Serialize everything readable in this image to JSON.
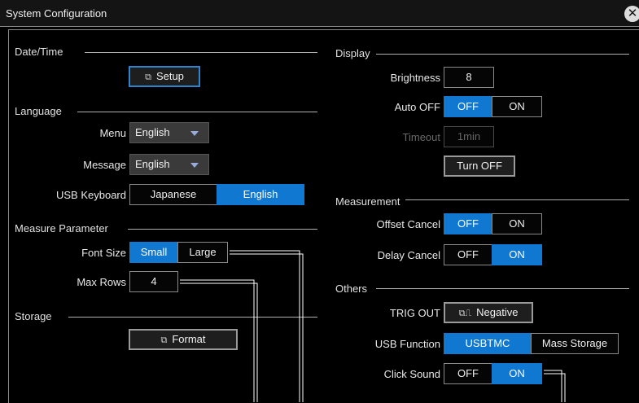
{
  "window": {
    "title": "System Configuration",
    "close_glyph": "✕"
  },
  "datetime": {
    "section": "Date/Time",
    "setup_label": "Setup",
    "setup_icon": "popup-icon"
  },
  "language": {
    "section": "Language",
    "menu_label": "Menu",
    "menu_value": "English",
    "message_label": "Message",
    "message_value": "English",
    "usb_keyboard_label": "USB Keyboard",
    "usb_keyboard_options": [
      "Japanese",
      "English"
    ],
    "usb_keyboard_selected": "English"
  },
  "measure_parameter": {
    "section": "Measure Parameter",
    "font_size_label": "Font Size",
    "font_size_options": [
      "Small",
      "Large"
    ],
    "font_size_selected": "Small",
    "max_rows_label": "Max Rows",
    "max_rows_value": "4"
  },
  "storage": {
    "section": "Storage",
    "format_label": "Format",
    "format_icon": "popup-icon"
  },
  "display": {
    "section": "Display",
    "brightness_label": "Brightness",
    "brightness_value": "8",
    "auto_off_label": "Auto OFF",
    "auto_off_options": [
      "OFF",
      "ON"
    ],
    "auto_off_selected": "OFF",
    "timeout_label": "Timeout",
    "timeout_value": "1min",
    "turn_off_label": "Turn OFF"
  },
  "measurement": {
    "section": "Measurement",
    "offset_cancel_label": "Offset Cancel",
    "offset_cancel_options": [
      "OFF",
      "ON"
    ],
    "offset_cancel_selected": "OFF",
    "delay_cancel_label": "Delay Cancel",
    "delay_cancel_options": [
      "OFF",
      "ON"
    ],
    "delay_cancel_selected": "ON"
  },
  "others": {
    "section": "Others",
    "trig_out_label": "TRIG OUT",
    "trig_out_value": "Negative",
    "trig_out_icon": "negative-pulse-icon",
    "usb_function_label": "USB Function",
    "usb_function_options": [
      "USBTMC",
      "Mass Storage"
    ],
    "usb_function_selected": "USBTMC",
    "click_sound_label": "Click Sound",
    "click_sound_options": [
      "OFF",
      "ON"
    ],
    "click_sound_selected": "ON"
  },
  "colors": {
    "accent": "#1078d0",
    "background": "#000000",
    "rule": "#b0b0b0"
  }
}
